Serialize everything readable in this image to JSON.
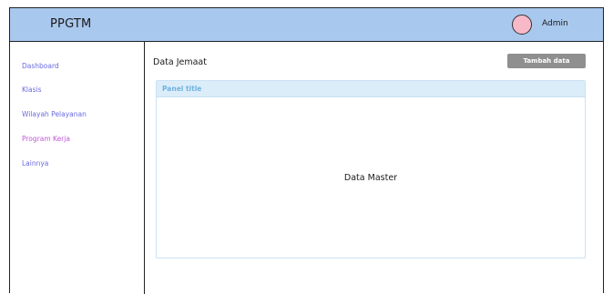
{
  "app": {
    "brand": "PPGTM",
    "user_name": "Admin"
  },
  "sidebar": {
    "items": [
      {
        "label": "Dashboard",
        "color": "#6a6ae0"
      },
      {
        "label": "Klasis",
        "color": "#6a6ae0"
      },
      {
        "label": "Wilayah Pelayanan",
        "color": "#6a6ae0"
      },
      {
        "label": "Program Kerja",
        "color": "#c05ad6"
      },
      {
        "label": "Lainnya",
        "color": "#6a6ae0"
      }
    ]
  },
  "main": {
    "page_title": "Data Jemaat",
    "add_button_label": "Tambah data",
    "panel": {
      "title": "Panel title",
      "body_text": "Data Master"
    }
  },
  "colors": {
    "topbar": "#a9c8ee",
    "avatar": "#f7b9c8",
    "button": "#8f8f8f",
    "panel_header": "#dcedfa",
    "panel_title": "#6fb3e0"
  }
}
